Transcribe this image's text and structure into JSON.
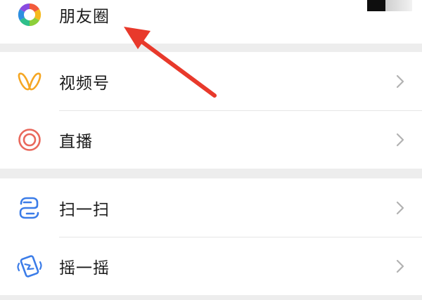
{
  "menu": {
    "moments": {
      "label": "朋友圈"
    },
    "channels": {
      "label": "视频号"
    },
    "live": {
      "label": "直播"
    },
    "scan": {
      "label": "扫一扫"
    },
    "shake": {
      "label": "摇一摇"
    }
  },
  "colors": {
    "background": "#ededed",
    "row_background": "#ffffff",
    "text": "#1a1a1a",
    "chevron": "#b2b2b2",
    "channels_icon": "#f5a623",
    "live_icon": "#e9685c",
    "scan_icon": "#3b7ce8",
    "annotation_arrow": "#e8392b"
  },
  "icons": {
    "moments": "camera-aperture-icon",
    "channels": "butterfly-icon",
    "live": "concentric-circle-icon",
    "scan": "scan-icon",
    "shake": "phone-shake-icon",
    "chevron": "chevron-right-icon"
  }
}
